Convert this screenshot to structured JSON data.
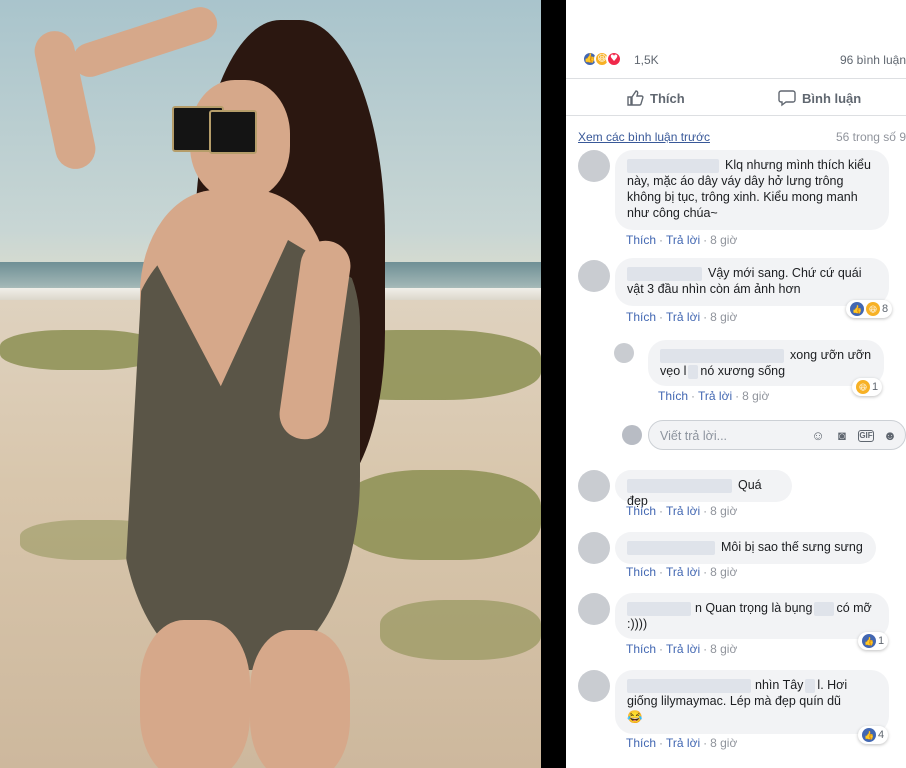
{
  "reactions": {
    "count": "1,5K",
    "comments_count": "96 bình luận",
    "icons": [
      "like-icon",
      "haha-icon",
      "love-icon"
    ],
    "colors": {
      "like": "#4267b2",
      "haha": "#f7b125",
      "love": "#f0284a"
    }
  },
  "actions": {
    "like": "Thích",
    "comment": "Bình luận"
  },
  "prev": {
    "label": "Xem các bình luận trước",
    "count": "56 trong số 9"
  },
  "comments": [
    {
      "text": "Klq nhưng mình thích kiểu này, mặc áo dây váy dây hở lưng trông không bị tục, trông xinh. Kiểu mong manh như công chúa~",
      "like": "Thích",
      "reply": "Trả lời",
      "time": "8 giờ"
    },
    {
      "text": "Vậy mới sang. Chứ cứ quái vật 3 đầu nhìn còn ám ảnh hơn",
      "like": "Thích",
      "reply": "Trả lời",
      "time": "8 giờ",
      "react_count": "8"
    },
    {
      "text_a": "xong ưỡn ưỡn",
      "text_b": "vẹo l",
      "text_c": "nó xương sống",
      "like": "Thích",
      "reply": "Trả lời",
      "time": "8 giờ",
      "react_count": "1"
    },
    {
      "text": "Quá đẹp",
      "like": "Thích",
      "reply": "Trả lời",
      "time": "8 giờ"
    },
    {
      "text": "Môi bị sao thế sưng sưng",
      "like": "Thích",
      "reply": "Trả lời",
      "time": "8 giờ"
    },
    {
      "text_a": "n Quan trọng là bụng",
      "text_b": "có mỡ",
      "text_c": ":))))",
      "like": "Thích",
      "reply": "Trả lời",
      "time": "8 giờ",
      "react_count": "1"
    },
    {
      "text_a": "nhìn Tây",
      "text_b": "l. Hơi",
      "text_c": "giống lilymaymac. Lép mà đẹp quín dũ",
      "emoji": "😂",
      "like": "Thích",
      "reply": "Trả lời",
      "time": "8 giờ",
      "react_count": "4"
    }
  ],
  "reply_box": {
    "placeholder": "Viết trả lời...",
    "tools": [
      "emoji-icon",
      "camera-icon",
      "gif-icon",
      "sticker-icon"
    ]
  }
}
